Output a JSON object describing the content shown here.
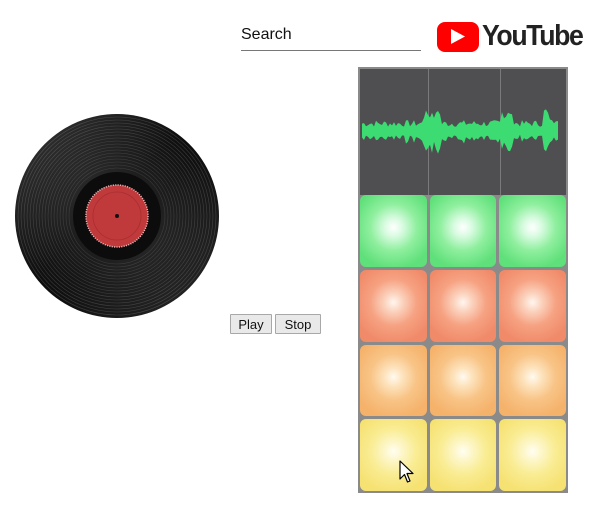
{
  "search": {
    "placeholder": "Search",
    "value": ""
  },
  "logo": {
    "word": "YouTube",
    "icon": "youtube-play-icon",
    "red": "#ff0000"
  },
  "controls": {
    "play_label": "Play",
    "stop_label": "Stop"
  },
  "record": {
    "icon": "vinyl-record-icon",
    "label_color": "#c0393b"
  },
  "sampler": {
    "screen_color": "#4f4f51",
    "waveform_color": "#3ddc72",
    "pad_colors": [
      "green",
      "red",
      "orange",
      "yellow"
    ],
    "rows": [
      [
        "green",
        "green",
        "green"
      ],
      [
        "red",
        "red",
        "red"
      ],
      [
        "orange",
        "orange",
        "orange"
      ],
      [
        "yellow",
        "yellow",
        "yellow"
      ]
    ]
  }
}
